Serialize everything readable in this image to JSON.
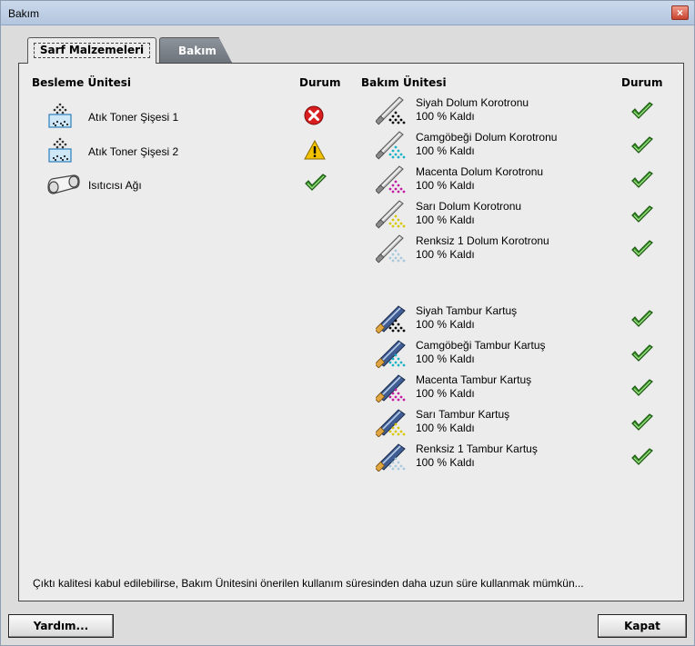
{
  "window": {
    "title": "Bakım",
    "close_glyph": "×"
  },
  "tabs": [
    {
      "label": "Sarf Malzemeleri",
      "active": true
    },
    {
      "label": "Bakım",
      "active": false
    }
  ],
  "left_section": {
    "header": "Besleme Ünitesi",
    "status_header": "Durum",
    "items": [
      {
        "label": "Atık Toner Şişesi 1",
        "icon": "toner-bottle-icon",
        "status": "error"
      },
      {
        "label": "Atık Toner Şişesi 2",
        "icon": "toner-bottle-icon",
        "status": "warning"
      },
      {
        "label": "Isıtıcısı Ağı",
        "icon": "fuser-web-icon",
        "status": "ok"
      }
    ]
  },
  "right_section": {
    "header": "Bakım Ünitesi",
    "status_header": "Durum",
    "corotrons": [
      {
        "name": "Siyah Dolum Korotronu",
        "remaining": "100 % Kaldı",
        "color": "#000000",
        "status": "ok"
      },
      {
        "name": "Camgöbeği Dolum Korotronu",
        "remaining": "100 % Kaldı",
        "color": "#19b3c8",
        "status": "ok"
      },
      {
        "name": "Macenta Dolum Korotronu",
        "remaining": "100 % Kaldı",
        "color": "#c21fa3",
        "status": "ok"
      },
      {
        "name": "Sarı Dolum Korotronu",
        "remaining": "100 % Kaldı",
        "color": "#d8c800",
        "status": "ok"
      },
      {
        "name": "Renksiz 1 Dolum Korotronu",
        "remaining": "100 % Kaldı",
        "color": "#a8c8dc",
        "status": "ok"
      }
    ],
    "drums": [
      {
        "name": "Siyah Tambur Kartuş",
        "remaining": "100 % Kaldı",
        "color": "#000000",
        "status": "ok"
      },
      {
        "name": "Camgöbeği Tambur Kartuş",
        "remaining": "100 % Kaldı",
        "color": "#19b3c8",
        "status": "ok"
      },
      {
        "name": "Macenta Tambur Kartuş",
        "remaining": "100 % Kaldı",
        "color": "#c21fa3",
        "status": "ok"
      },
      {
        "name": "Sarı Tambur Kartuş",
        "remaining": "100 % Kaldı",
        "color": "#d8c800",
        "status": "ok"
      },
      {
        "name": "Renksiz 1 Tambur Kartuş",
        "remaining": "100 % Kaldı",
        "color": "#a8c8dc",
        "status": "ok"
      }
    ]
  },
  "footer_note": "Çıktı kalitesi kabul edilebilirse, Bakım Ünitesini önerilen kullanım süresinden daha uzun süre kullanmak mümkün...",
  "buttons": {
    "help": "Yardım...",
    "close": "Kapat"
  },
  "status_colors": {
    "error": "#d81e1e",
    "warning": "#f2c200",
    "ok": "#3c9a2a"
  }
}
